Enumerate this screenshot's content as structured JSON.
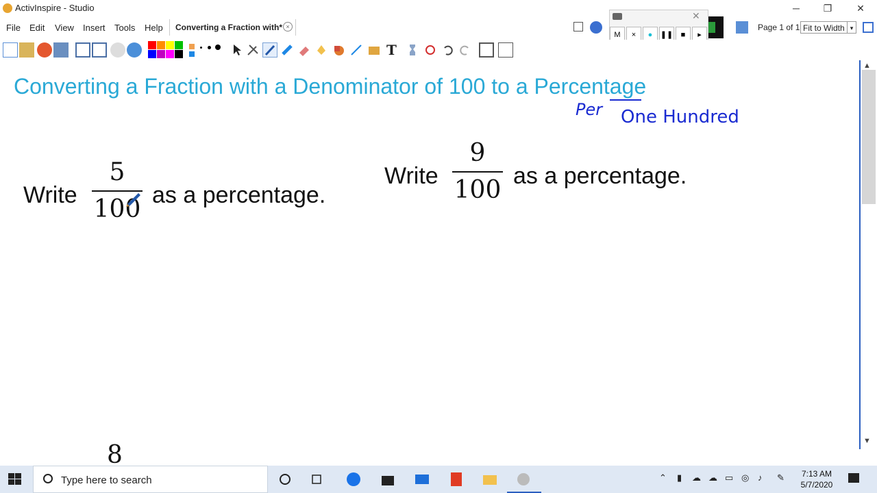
{
  "window": {
    "title": "ActivInspire - Studio",
    "minimize": "─",
    "restore": "❐",
    "close": "✕"
  },
  "menu": [
    "File",
    "Edit",
    "View",
    "Insert",
    "Tools",
    "Help"
  ],
  "doc_tab": {
    "label": "Converting a Fraction with*",
    "close": "×"
  },
  "page_indicator": "Page 1 of 1",
  "zoom": {
    "value": "Fit to Width",
    "arrow": "▾"
  },
  "recorder": {
    "buttons": [
      "M",
      "×",
      "●",
      "❚❚",
      "■",
      "▸"
    ]
  },
  "colors": {
    "heading": "#2aa9d6",
    "handwriting": "#1a2bd1",
    "taskbar": "#dfe8f4",
    "accent": "#2b5fc0"
  },
  "toolbar_swatches": [
    "#ff0000",
    "#ff8c00",
    "#ffff00",
    "#00c000",
    "#0000ff",
    "#c000c0",
    "#ff00ff",
    "#000000"
  ],
  "content": {
    "heading": "Converting a Fraction with a Denominator of 100 to a Percentage",
    "handwriting_per": "Per",
    "handwriting_rest": "One Hundred",
    "problem1": {
      "write": "Write",
      "numerator": "5",
      "denominator": "100",
      "suffix": "as a percentage."
    },
    "problem2": {
      "write": "Write",
      "numerator": "9",
      "denominator": "100",
      "suffix": "as a percentage."
    },
    "partial_numerator": "8"
  },
  "taskbar": {
    "search_placeholder": "Type here to search",
    "time": "7:13 AM",
    "date": "5/7/2020"
  }
}
